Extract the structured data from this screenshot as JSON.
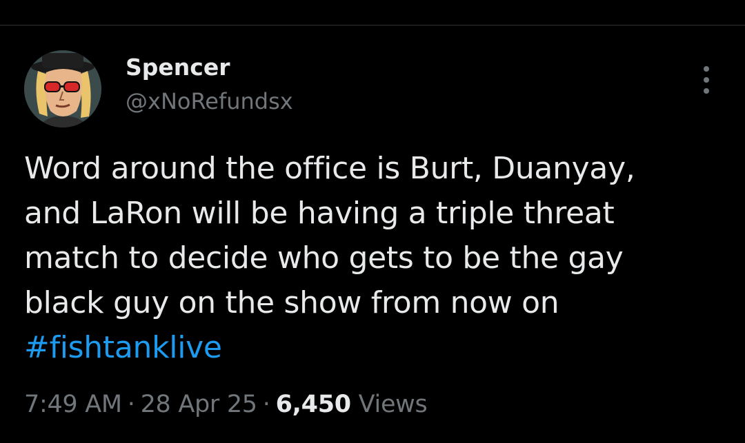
{
  "user": {
    "display_name": "Spencer",
    "handle": "@xNoRefundsx"
  },
  "tweet": {
    "lines": [
      "Word around the office is Burt, Duanyay,",
      "and LaRon will be having a triple threat",
      "match to decide who gets to be the gay",
      "black guy on the show from now on"
    ],
    "hashtag": "#fishtanklive"
  },
  "meta": {
    "time": "7:49 AM",
    "date": "28 Apr 25",
    "separator": "·",
    "views_count": "6,450",
    "views_label": "Views"
  },
  "icons": {
    "more": "more-vertical-icon"
  },
  "colors": {
    "background": "#000000",
    "text_primary": "#e7e9ea",
    "text_secondary": "#71767b",
    "link": "#1d9bf0",
    "divider": "#2f3336"
  }
}
